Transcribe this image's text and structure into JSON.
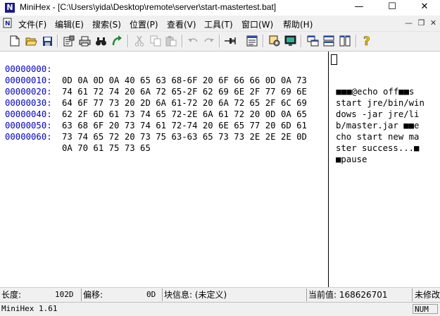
{
  "window": {
    "app_name": "MiniHex",
    "file_path": "[C:\\Users\\yida\\Desktop\\remote\\server\\start-mastertest.bat]",
    "minimize_glyph": "—",
    "maximize_glyph": "☐",
    "close_glyph": "✕"
  },
  "menu": {
    "items": [
      {
        "label": "文件(F)"
      },
      {
        "label": "编辑(E)"
      },
      {
        "label": "搜索(S)"
      },
      {
        "label": "位置(P)"
      },
      {
        "label": "查看(V)"
      },
      {
        "label": "工具(T)"
      },
      {
        "label": "窗口(W)"
      },
      {
        "label": "帮助(H)"
      }
    ],
    "mdi_minimize": "—",
    "mdi_restore": "❐",
    "mdi_close": "✕"
  },
  "toolbar": {
    "buttons": [
      {
        "name": "new-file-icon"
      },
      {
        "name": "open-folder-icon"
      },
      {
        "name": "save-icon"
      },
      {
        "name": "properties-icon"
      },
      {
        "name": "print-icon"
      },
      {
        "name": "find-binoculars-icon"
      },
      {
        "name": "goto-arrow-icon"
      },
      {
        "name": "cut-icon"
      },
      {
        "name": "copy-icon"
      },
      {
        "name": "paste-icon"
      },
      {
        "name": "undo-icon"
      },
      {
        "name": "redo-icon"
      },
      {
        "name": "pin-icon"
      },
      {
        "name": "document-view-icon"
      },
      {
        "name": "settings-icon"
      },
      {
        "name": "monitor-icon"
      },
      {
        "name": "cascade-windows-icon"
      },
      {
        "name": "tile-horizontal-icon"
      },
      {
        "name": "tile-vertical-icon"
      },
      {
        "name": "help-icon"
      }
    ],
    "colors": {
      "save": "#1a3d8f",
      "find": "#202020",
      "goto": "#1c8a2e",
      "help": "#f2c400"
    }
  },
  "editor": {
    "rows": [
      {
        "address": "00000000:",
        "hex": "0D 0A 0D 0A 40 65 63 68-6F 20 6F 66 66 0D 0A 73",
        "ascii": " ■■■@echo off■■s"
      },
      {
        "address": "00000010:",
        "hex": "74 61 72 74 20 6A 72 65-2F 62 69 6E 2F 77 69 6E",
        "ascii": "start jre/bin/win"
      },
      {
        "address": "00000020:",
        "hex": "64 6F 77 73 20 2D 6A 61-72 20 6A 72 65 2F 6C 69",
        "ascii": "dows -jar jre/li"
      },
      {
        "address": "00000030:",
        "hex": "62 2F 6D 61 73 74 65 72-2E 6A 61 72 20 0D 0A 65",
        "ascii": "b/master.jar ■■e"
      },
      {
        "address": "00000040:",
        "hex": "63 68 6F 20 73 74 61 72-74 20 6E 65 77 20 6D 61",
        "ascii": "cho start new ma"
      },
      {
        "address": "00000050:",
        "hex": "73 74 65 72 20 73 75 63-63 65 73 73 2E 2E 2E 0D",
        "ascii": "ster success...■"
      },
      {
        "address": "00000060:",
        "hex": "0A 70 61 75 73 65",
        "ascii": "■pause"
      }
    ],
    "address_color": "#0000c8"
  },
  "status": {
    "length_label": "长度:",
    "length_value": "102D",
    "offset_label": "偏移:",
    "offset_value": "0D",
    "block_info": "块信息: (未定义)",
    "current_value": "当前值: 168626701",
    "modified": "未修改"
  },
  "bottom": {
    "version": "MiniHex 1.61",
    "num_indicator": "NUM"
  }
}
